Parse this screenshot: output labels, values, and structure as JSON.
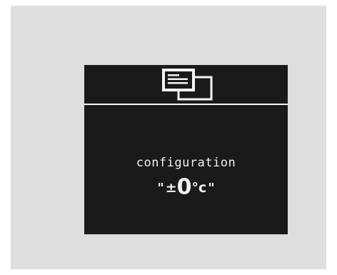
{
  "header": {
    "icon": "menu-list-icon"
  },
  "body": {
    "title": "configuration",
    "value": {
      "open_quote": "\"",
      "sign": "±",
      "number": "0",
      "unit": "°c",
      "close_quote": "\""
    }
  },
  "colors": {
    "screen_background": "#1a1a1a",
    "frame_background": "#dedede",
    "foreground": "#f2f2f2"
  }
}
